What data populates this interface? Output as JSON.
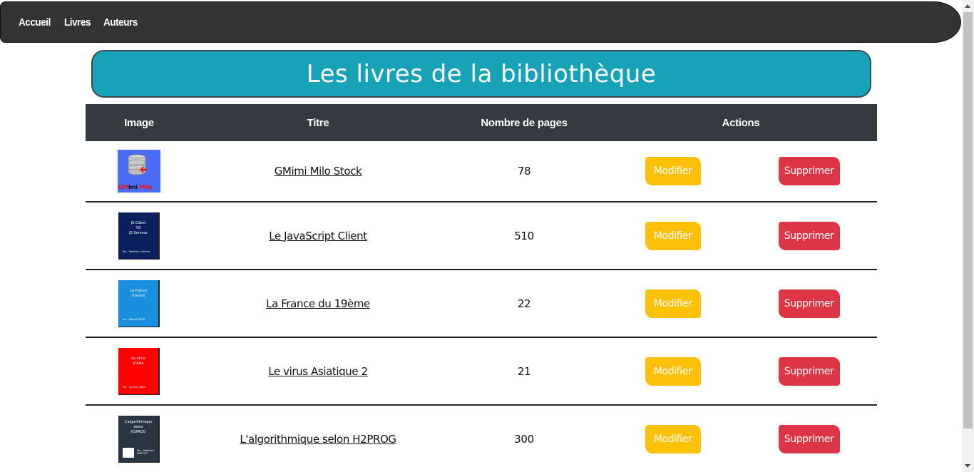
{
  "nav": {
    "links": [
      {
        "label": "Accueil"
      },
      {
        "label": "Livres"
      },
      {
        "label": "Auteurs"
      }
    ]
  },
  "page_title": "Les livres de la bibliothèque",
  "table": {
    "headers": {
      "image": "Image",
      "title": "Titre",
      "pages": "Nombre de pages",
      "actions": "Actions"
    },
    "rows": [
      {
        "title": "GMimi Milo Stock",
        "pages": "78",
        "cover": {
          "bg": "#4a6cf7",
          "label_a": "GM",
          "label_b": "imi",
          "label_c": " Milo"
        },
        "modify": "Modifier",
        "delete": "Supprimer"
      },
      {
        "title": "Le JavaScript Client",
        "pages": "510",
        "cover": {
          "bg": "#0b1f5c",
          "lines": [
            "JS Client",
            "VS",
            "JS Serveur"
          ],
          "author": "Par : Matthieu Gaston"
        },
        "modify": "Modifier",
        "delete": "Supprimer"
      },
      {
        "title": "La France du 19ème",
        "pages": "22",
        "cover": {
          "bg": "#1a8fe0",
          "lines": [
            "La France",
            "d'avant"
          ],
          "author": "Par : Robert PROS"
        },
        "modify": "Modifier",
        "delete": "Supprimer"
      },
      {
        "title": "Le virus Asiatique 2",
        "pages": "21",
        "cover": {
          "bg": "#ff0000",
          "lines": [
            "Le virus",
            "d'Asie"
          ],
          "author": "Par : Corinne Biron"
        },
        "modify": "Modifier",
        "delete": "Supprimer"
      },
      {
        "title": "L'algorithmique selon H2PROG",
        "pages": "300",
        "cover": {
          "bg": "#2a3544",
          "lines": [
            "L'algorithmique",
            "selon",
            "H2PROG"
          ],
          "author": "Par : Matthieu GASTON"
        },
        "modify": "Modifier",
        "delete": "Supprimer"
      }
    ]
  },
  "colors": {
    "navbar": "#333333",
    "banner": "#17a2b8",
    "header": "#343a40",
    "modify": "#ffc107",
    "delete": "#dc3545"
  }
}
